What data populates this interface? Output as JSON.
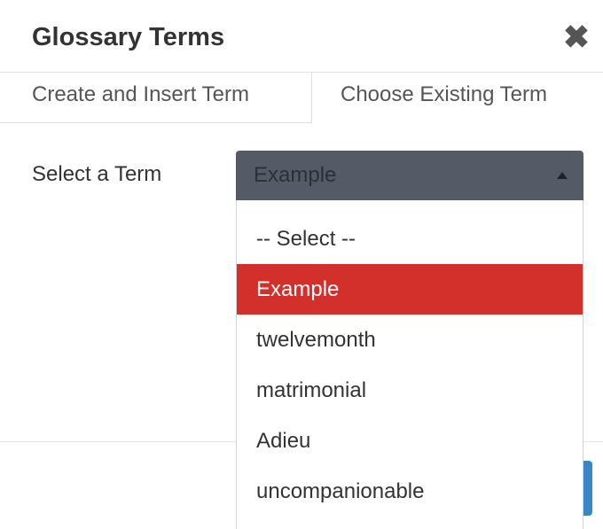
{
  "dialog": {
    "title": "Glossary Terms",
    "close_glyph": "✖"
  },
  "tabs": [
    {
      "label": "Create and Insert Term",
      "active": false
    },
    {
      "label": "Choose Existing Term",
      "active": true
    }
  ],
  "form": {
    "label": "Select a Term",
    "selected_value": "Example"
  },
  "dropdown": {
    "options": [
      "-- Select --",
      "Example",
      "twelvemonth",
      "matrimonial",
      "Adieu",
      "uncompanionable"
    ],
    "highlighted": "Example"
  },
  "colors": {
    "highlight": "#d32f2b",
    "select_background": "#555b66",
    "primary_button": "#3a87c8"
  }
}
